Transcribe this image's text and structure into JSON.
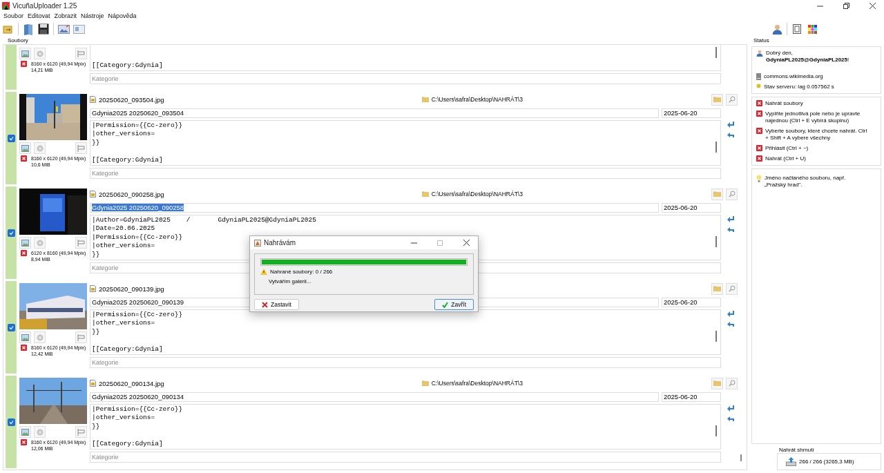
{
  "window": {
    "title": "VicuñaUploader 1.25"
  },
  "menu": [
    "Soubor",
    "Editovat",
    "Zobrazit",
    "Nástroje",
    "Nápověda"
  ],
  "files_panel": {
    "title": "Soubory",
    "files": [
      {
        "description": "[[Category:Gdynia]",
        "category_placeholder": "Kategorie",
        "dimensions": "8160 x 6120 (49,94 Mpix)",
        "size": "14,21 MiB"
      },
      {
        "checked": true,
        "filename": "20250620_093504.jpg",
        "path": "C:\\Users\\safra\\Desktop\\NAHRÁT\\3",
        "title": "Gdynia2025 20250620_093504",
        "title_selected": false,
        "date": "2025-06-20",
        "description": "|Permission={{Cc-zero}}\n|other_versions=\n}}\n\n[[Category:Gdynia]",
        "category_placeholder": "Kategorie",
        "dimensions": "8160 x 6120 (49,94 Mpix)",
        "size": "10,6 MiB"
      },
      {
        "checked": true,
        "filename": "20250620_090258.jpg",
        "path": "C:\\Users\\safra\\Desktop\\NAHRÁT\\3",
        "title": "Gdynia2025 20250620_090258",
        "title_selected": true,
        "date": "2025-06-20",
        "description": "|Author=GdyniaPL2025    /       GdyniaPL2025@GdyniaPL2025\n|Date=20.06.2025\n|Permission={{Cc-zero}}\n|other_versions=\n}}",
        "category_placeholder": "Kategorie",
        "dimensions": "6120 x 8160 (49,94 Mpix)",
        "size": "8,94 MiB"
      },
      {
        "checked": true,
        "filename": "20250620_090139.jpg",
        "title": "Gdynia2025 20250620_090139",
        "title_selected": false,
        "date": "2025-06-20",
        "description": "|Permission={{Cc-zero}}\n|other_versions=\n}}\n\n[[Category:Gdynia]",
        "category_placeholder": "Kategorie",
        "dimensions": "8160 x 6120 (49,94 Mpix)",
        "size": "12,42 MiB"
      },
      {
        "checked": true,
        "filename": "20250620_090134.jpg",
        "path": "C:\\Users\\safra\\Desktop\\NAHRÁT\\3",
        "title": "Gdynia2025 20250620_090134",
        "title_selected": false,
        "date": "2025-06-20",
        "description": "|Permission={{Cc-zero}}\n|other_versions=\n}}\n\n[[Category:Gdynia]",
        "category_placeholder": "Kategorie",
        "dimensions": "8160 x 6120 (49,94 Mpix)",
        "size": "12,06 MiB"
      }
    ]
  },
  "status": {
    "title": "Status",
    "greeting": "Dobrý den, **GdyniaPL2025@GdyniaPL2025**!",
    "server": "commons.wikimedia.org",
    "server_state": "Stav serveru: lag 0.057562 s"
  },
  "steps": [
    "Nahrát soubory",
    "Vyplňte jednotlivá pole nebo je upravte najednou (Ctrl + E vybírá skupinu)",
    "Vyberte soubory, které chcete nahrát. Ctrl + Shift + A vybere všechny",
    "Přihlásit (Ctrl + ~)",
    "Nahrát (Ctrl + U)"
  ],
  "tip": "Jméno načtaného souboru, např. „Pražský hrad\".",
  "summary": {
    "title": "Nahrát shrnutí",
    "text": "266 / 266 (3265,3 MB)"
  },
  "dialog": {
    "title": "Nahrávám",
    "level": 1,
    "progress_label": "Nahrané soubory: 0 / 266",
    "message": "Vytvářím galerii...",
    "buttons": [
      {
        "label": "Zastavit",
        "kind": "stop",
        "focused": false
      },
      {
        "label": "Zavřít",
        "kind": "close",
        "focused": true
      }
    ]
  }
}
